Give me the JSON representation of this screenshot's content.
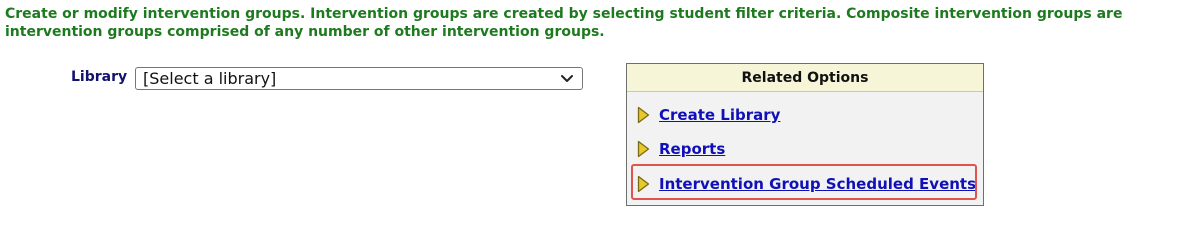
{
  "intro": {
    "line1": "Create or modify intervention groups. Intervention groups are created by selecting student filter criteria. Composite intervention groups are",
    "line2": "intervention groups comprised of any number of other intervention groups."
  },
  "library": {
    "label": "Library",
    "selected": "[Select a library]"
  },
  "related_options": {
    "title": "Related Options",
    "items": [
      {
        "label": "Create Library",
        "icon": "arrow-right-icon"
      },
      {
        "label": "Reports",
        "icon": "arrow-right-icon"
      },
      {
        "label": "Intervention Group Scheduled Events",
        "icon": "arrow-right-icon",
        "highlighted": true
      }
    ]
  },
  "colors": {
    "intro_text": "#1e7a1e",
    "label_text": "#13136e",
    "link": "#1010b8",
    "panel_header_bg": "#f6f5d8",
    "panel_bg": "#f2f2f2",
    "arrow_fill": "#e8c92c",
    "highlight_border": "#e0524e"
  }
}
